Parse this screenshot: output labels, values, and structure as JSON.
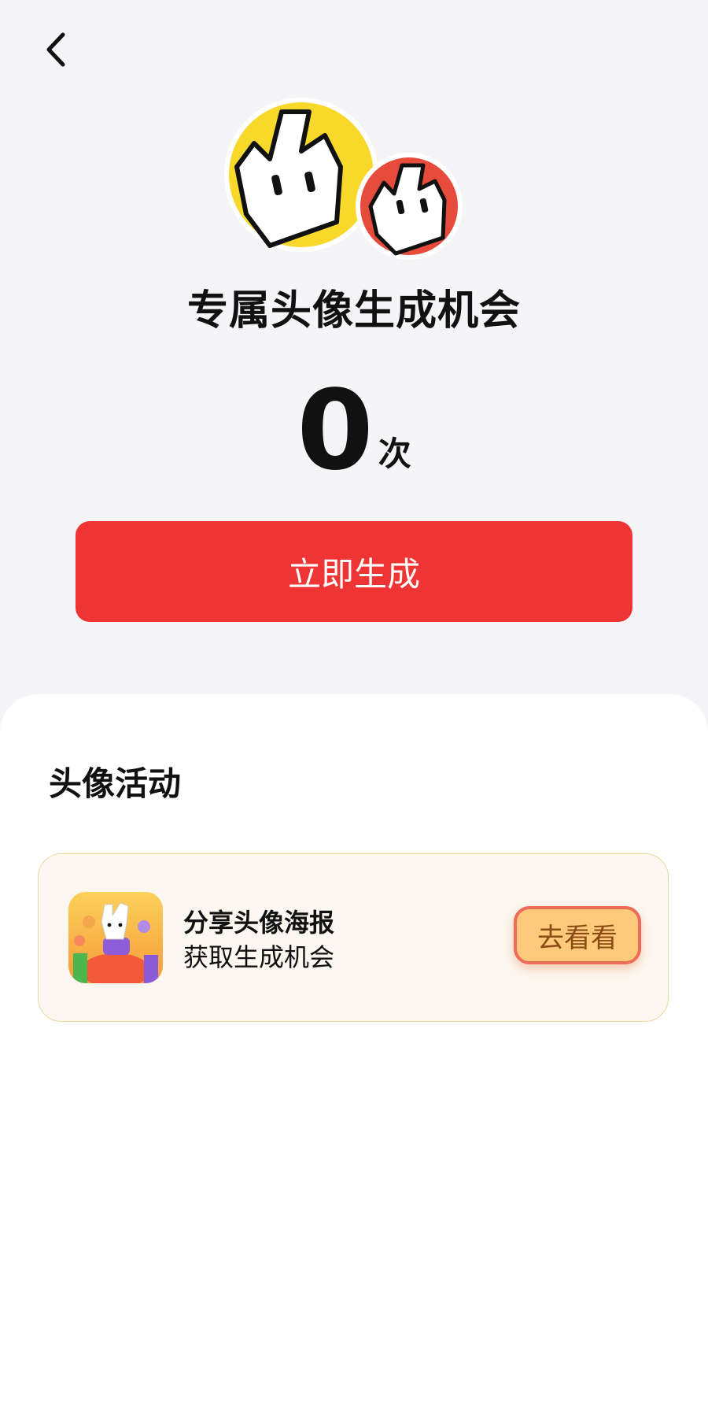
{
  "header": {
    "back_icon": "chevron-left-icon"
  },
  "hero": {
    "title": "专属头像生成机会",
    "count_value": "0",
    "count_unit": "次",
    "generate_button": "立即生成",
    "avatar_colors": {
      "yellow": "#f8d82a",
      "red": "#e74b3c"
    }
  },
  "activities": {
    "section_title": "头像活动",
    "items": [
      {
        "line1": "分享头像海报",
        "line2": "获取生成机会",
        "button": "去看看"
      }
    ]
  },
  "colors": {
    "accent": "#ef3434",
    "card_bg": "#fcf7f0",
    "go_btn_bg": "#fdc97a",
    "go_btn_border": "#ee6b5a"
  }
}
